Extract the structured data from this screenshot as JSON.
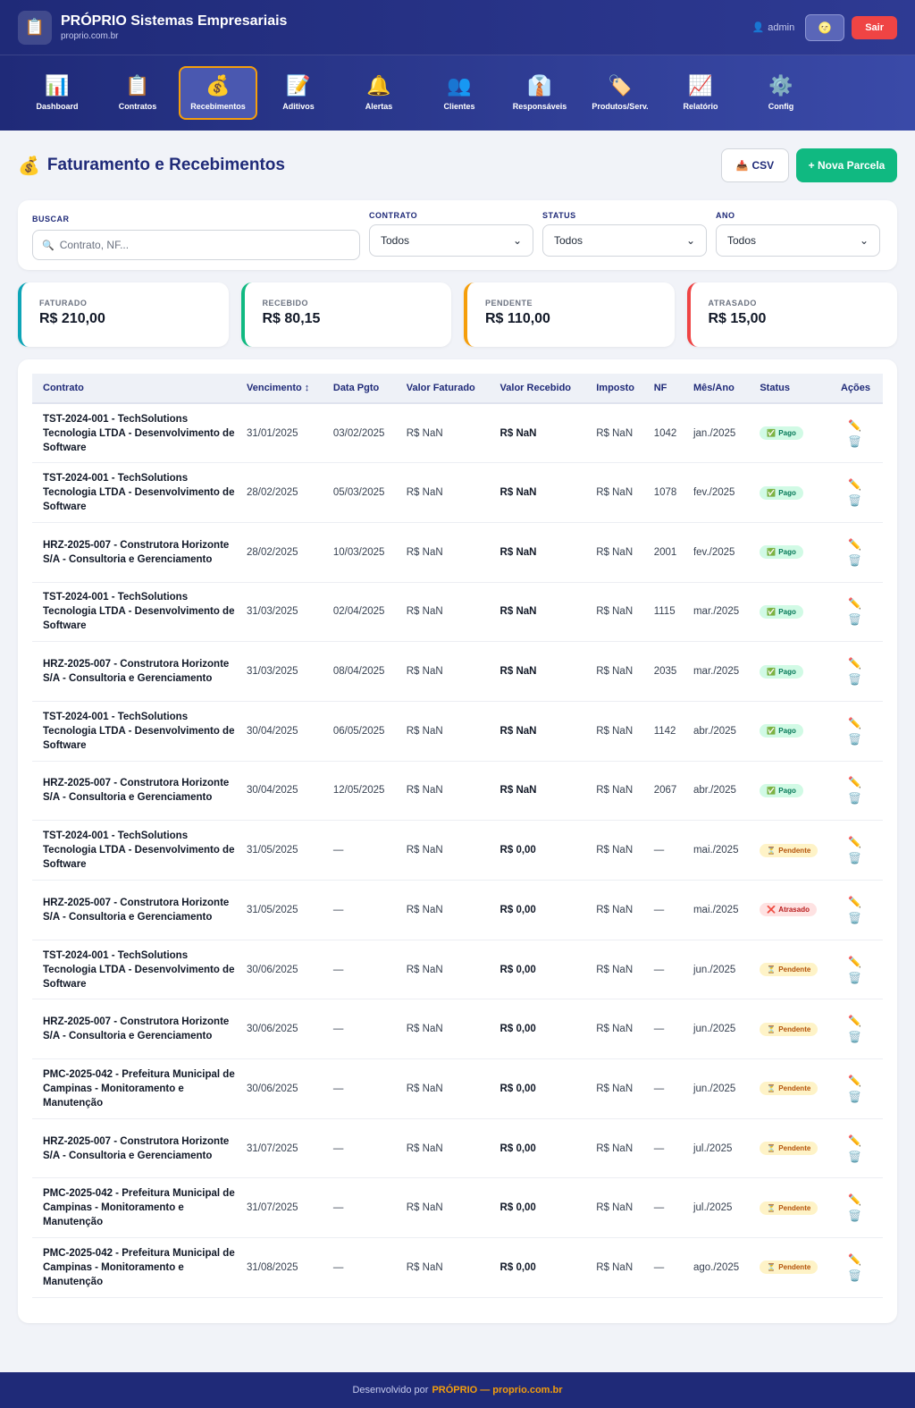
{
  "header": {
    "brand_title": "PRÓPRIO Sistemas Empresariais",
    "brand_sub": "proprio.com.br",
    "logo_icon": "📋",
    "user_icon": "👤",
    "user": "admin",
    "theme_icon": "🌝",
    "logout": "Sair"
  },
  "nav": [
    {
      "icon": "📊",
      "label": "Dashboard"
    },
    {
      "icon": "📋",
      "label": "Contratos"
    },
    {
      "icon": "💰",
      "label": "Recebimentos",
      "active": true
    },
    {
      "icon": "📝",
      "label": "Aditivos"
    },
    {
      "icon": "🔔",
      "label": "Alertas"
    },
    {
      "icon": "👥",
      "label": "Clientes"
    },
    {
      "icon": "👔",
      "label": "Responsáveis"
    },
    {
      "icon": "🏷️",
      "label": "Produtos/Serv."
    },
    {
      "icon": "📈",
      "label": "Relatório"
    },
    {
      "icon": "⚙️",
      "label": "Config"
    }
  ],
  "page": {
    "icon": "💰",
    "title": "Faturamento e Recebimentos",
    "csv_icon": "📥",
    "csv_label": "CSV",
    "new_label": "+ Nova Parcela"
  },
  "filters": {
    "search_label": "BUSCAR",
    "search_icon": "🔍",
    "search_placeholder": "Contrato, NF...",
    "contrato_label": "CONTRATO",
    "contrato_value": "Todos",
    "status_label": "STATUS",
    "status_value": "Todos",
    "ano_label": "ANO",
    "ano_value": "Todos"
  },
  "stats": [
    {
      "label": "FATURADO",
      "value": "R$ 210,00",
      "color": "#0ea5b7"
    },
    {
      "label": "RECEBIDO",
      "value": "R$ 80,15",
      "color": "#10b981"
    },
    {
      "label": "PENDENTE",
      "value": "R$ 110,00",
      "color": "#f59e0b"
    },
    {
      "label": "ATRASADO",
      "value": "R$ 15,00",
      "color": "#ef4444"
    }
  ],
  "table": {
    "columns": [
      "Contrato",
      "Vencimento ↕",
      "Data Pgto",
      "Valor Faturado",
      "Valor Recebido",
      "Imposto",
      "NF",
      "Mês/Ano",
      "Status",
      "Ações"
    ],
    "edit_icon": "✏️",
    "delete_icon": "🗑️",
    "rows": [
      {
        "contrato": "TST-2024-001 - TechSolutions Tecnologia LTDA - Desenvolvimento de Software",
        "venc": "31/01/2025",
        "pgto": "03/02/2025",
        "fat": "R$ NaN",
        "rec": "R$ NaN",
        "imp": "R$ NaN",
        "nf": "1042",
        "mes": "jan./2025",
        "status": "Pago",
        "status_icon": "✅",
        "kind": "pago"
      },
      {
        "contrato": "TST-2024-001 - TechSolutions Tecnologia LTDA - Desenvolvimento de Software",
        "venc": "28/02/2025",
        "pgto": "05/03/2025",
        "fat": "R$ NaN",
        "rec": "R$ NaN",
        "imp": "R$ NaN",
        "nf": "1078",
        "mes": "fev./2025",
        "status": "Pago",
        "status_icon": "✅",
        "kind": "pago"
      },
      {
        "contrato": "HRZ-2025-007 - Construtora Horizonte S/A - Consultoria e Gerenciamento",
        "venc": "28/02/2025",
        "pgto": "10/03/2025",
        "fat": "R$ NaN",
        "rec": "R$ NaN",
        "imp": "R$ NaN",
        "nf": "2001",
        "mes": "fev./2025",
        "status": "Pago",
        "status_icon": "✅",
        "kind": "pago"
      },
      {
        "contrato": "TST-2024-001 - TechSolutions Tecnologia LTDA - Desenvolvimento de Software",
        "venc": "31/03/2025",
        "pgto": "02/04/2025",
        "fat": "R$ NaN",
        "rec": "R$ NaN",
        "imp": "R$ NaN",
        "nf": "1115",
        "mes": "mar./2025",
        "status": "Pago",
        "status_icon": "✅",
        "kind": "pago"
      },
      {
        "contrato": "HRZ-2025-007 - Construtora Horizonte S/A - Consultoria e Gerenciamento",
        "venc": "31/03/2025",
        "pgto": "08/04/2025",
        "fat": "R$ NaN",
        "rec": "R$ NaN",
        "imp": "R$ NaN",
        "nf": "2035",
        "mes": "mar./2025",
        "status": "Pago",
        "status_icon": "✅",
        "kind": "pago"
      },
      {
        "contrato": "TST-2024-001 - TechSolutions Tecnologia LTDA - Desenvolvimento de Software",
        "venc": "30/04/2025",
        "pgto": "06/05/2025",
        "fat": "R$ NaN",
        "rec": "R$ NaN",
        "imp": "R$ NaN",
        "nf": "1142",
        "mes": "abr./2025",
        "status": "Pago",
        "status_icon": "✅",
        "kind": "pago"
      },
      {
        "contrato": "HRZ-2025-007 - Construtora Horizonte S/A - Consultoria e Gerenciamento",
        "venc": "30/04/2025",
        "pgto": "12/05/2025",
        "fat": "R$ NaN",
        "rec": "R$ NaN",
        "imp": "R$ NaN",
        "nf": "2067",
        "mes": "abr./2025",
        "status": "Pago",
        "status_icon": "✅",
        "kind": "pago"
      },
      {
        "contrato": "TST-2024-001 - TechSolutions Tecnologia LTDA - Desenvolvimento de Software",
        "venc": "31/05/2025",
        "pgto": "—",
        "fat": "R$ NaN",
        "rec": "R$ 0,00",
        "imp": "R$ NaN",
        "nf": "—",
        "mes": "mai./2025",
        "status": "Pendente",
        "status_icon": "⏳",
        "kind": "pend"
      },
      {
        "contrato": "HRZ-2025-007 - Construtora Horizonte S/A - Consultoria e Gerenciamento",
        "venc": "31/05/2025",
        "pgto": "—",
        "fat": "R$ NaN",
        "rec": "R$ 0,00",
        "imp": "R$ NaN",
        "nf": "—",
        "mes": "mai./2025",
        "status": "Atrasado",
        "status_icon": "❌",
        "kind": "atr"
      },
      {
        "contrato": "TST-2024-001 - TechSolutions Tecnologia LTDA - Desenvolvimento de Software",
        "venc": "30/06/2025",
        "pgto": "—",
        "fat": "R$ NaN",
        "rec": "R$ 0,00",
        "imp": "R$ NaN",
        "nf": "—",
        "mes": "jun./2025",
        "status": "Pendente",
        "status_icon": "⏳",
        "kind": "pend"
      },
      {
        "contrato": "HRZ-2025-007 - Construtora Horizonte S/A - Consultoria e Gerenciamento",
        "venc": "30/06/2025",
        "pgto": "—",
        "fat": "R$ NaN",
        "rec": "R$ 0,00",
        "imp": "R$ NaN",
        "nf": "—",
        "mes": "jun./2025",
        "status": "Pendente",
        "status_icon": "⏳",
        "kind": "pend"
      },
      {
        "contrato": "PMC-2025-042 - Prefeitura Municipal de Campinas - Monitoramento e Manutenção",
        "venc": "30/06/2025",
        "pgto": "—",
        "fat": "R$ NaN",
        "rec": "R$ 0,00",
        "imp": "R$ NaN",
        "nf": "—",
        "mes": "jun./2025",
        "status": "Pendente",
        "status_icon": "⏳",
        "kind": "pend"
      },
      {
        "contrato": "HRZ-2025-007 - Construtora Horizonte S/A - Consultoria e Gerenciamento",
        "venc": "31/07/2025",
        "pgto": "—",
        "fat": "R$ NaN",
        "rec": "R$ 0,00",
        "imp": "R$ NaN",
        "nf": "—",
        "mes": "jul./2025",
        "status": "Pendente",
        "status_icon": "⏳",
        "kind": "pend"
      },
      {
        "contrato": "PMC-2025-042 - Prefeitura Municipal de Campinas - Monitoramento e Manutenção",
        "venc": "31/07/2025",
        "pgto": "—",
        "fat": "R$ NaN",
        "rec": "R$ 0,00",
        "imp": "R$ NaN",
        "nf": "—",
        "mes": "jul./2025",
        "status": "Pendente",
        "status_icon": "⏳",
        "kind": "pend"
      },
      {
        "contrato": "PMC-2025-042 - Prefeitura Municipal de Campinas - Monitoramento e Manutenção",
        "venc": "31/08/2025",
        "pgto": "—",
        "fat": "R$ NaN",
        "rec": "R$ 0,00",
        "imp": "R$ NaN",
        "nf": "—",
        "mes": "ago./2025",
        "status": "Pendente",
        "status_icon": "⏳",
        "kind": "pend"
      }
    ]
  },
  "footer": {
    "prefix": "Desenvolvido por",
    "brand": "PRÓPRIO — proprio.com.br"
  }
}
